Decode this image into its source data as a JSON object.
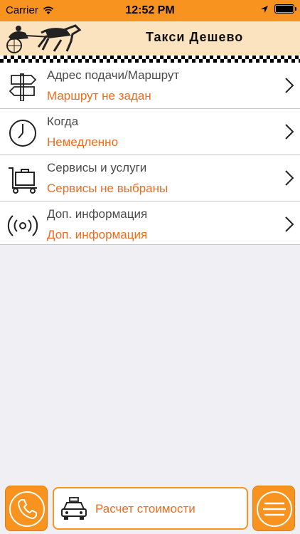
{
  "status_bar": {
    "carrier": "Carrier",
    "time": "12:52 PM",
    "wifi_icon": "wifi-icon",
    "location_icon": "location-arrow-icon",
    "battery_icon": "battery-icon"
  },
  "header": {
    "title": "Такси Дешево",
    "logo_icon": "horse-carriage-logo"
  },
  "menu": {
    "items": [
      {
        "label": "Адрес подачи/Маршрут",
        "value": "Маршрут не задан",
        "icon": "signpost-icon"
      },
      {
        "label": "Когда",
        "value": "Немедленно",
        "icon": "clock-icon"
      },
      {
        "label": "Сервисы и услуги",
        "value": "Сервисы не выбраны",
        "icon": "luggage-cart-icon"
      },
      {
        "label": "Доп. информация",
        "value": "Доп. информация",
        "icon": "broadcast-icon"
      }
    ]
  },
  "bottom_bar": {
    "calc_label": "Расчет стоимости",
    "phone_icon": "phone-icon",
    "taxi_icon": "taxi-car-icon",
    "menu_icon": "hamburger-icon"
  },
  "colors": {
    "accent": "#f7931e",
    "value_text": "#f26b1d",
    "header_bg": "#fbe3bf"
  }
}
